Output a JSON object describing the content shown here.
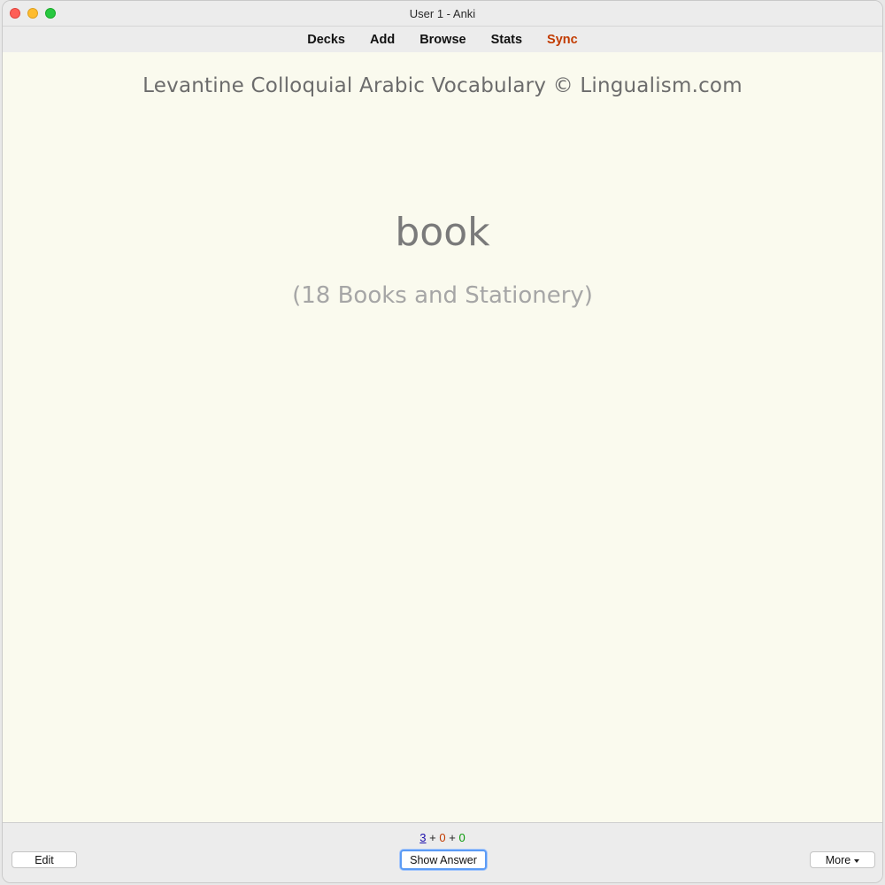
{
  "window": {
    "title": "User 1 - Anki"
  },
  "toolbar": {
    "items": [
      {
        "label": "Decks"
      },
      {
        "label": "Add"
      },
      {
        "label": "Browse"
      },
      {
        "label": "Stats"
      },
      {
        "label": "Sync"
      }
    ],
    "sync_color": "#c23b00"
  },
  "card": {
    "deck_title": "Levantine Colloquial Arabic Vocabulary © Lingualism.com",
    "word": "book",
    "category": "(18 Books and Stationery)",
    "background": "#fafaee"
  },
  "bottom": {
    "counts": {
      "new": "3",
      "learn": "0",
      "due": "0",
      "sep": "+"
    },
    "edit_label": "Edit",
    "show_answer_label": "Show Answer",
    "more_label": "More"
  }
}
